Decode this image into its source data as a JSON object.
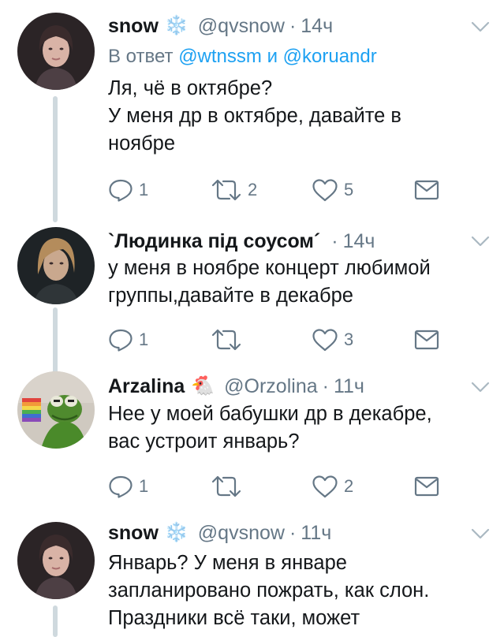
{
  "tweets": [
    {
      "name": "snow",
      "emoji": "❄️",
      "handle": "@qvsnow",
      "separator": "·",
      "time": "14ч",
      "reply_prefix": "В ответ",
      "reply_user1": "@wtnssm",
      "reply_and": "и",
      "reply_user2": "@koruandr",
      "lines": [
        "Ля, чё в октябре?",
        "У меня др в октябре, давайте в",
        "ноябре"
      ],
      "replies": "1",
      "retweets": "2",
      "likes": "5"
    },
    {
      "name": "`Людинка під соусом´",
      "handle": "",
      "separator": "·",
      "time": "14ч",
      "lines": [
        "у меня в ноябре концерт любимой",
        "группы,давайте в декабре"
      ],
      "replies": "1",
      "retweets": "",
      "likes": "3"
    },
    {
      "name": "Arzalina",
      "emoji": "🐔",
      "handle": "@Orzolina",
      "separator": "·",
      "time": "11ч",
      "lines": [
        "Нее у моей бабушки др в декабре,",
        "вас устроит январь?"
      ],
      "replies": "1",
      "retweets": "",
      "likes": "2"
    },
    {
      "name": "snow",
      "emoji": "❄️",
      "handle": "@qvsnow",
      "separator": "·",
      "time": "11ч",
      "lines": [
        "Январь?  У меня в январе",
        "запланировано пожрать, как слон.",
        "Праздники всё таки, может"
      ]
    }
  ],
  "colors": {
    "text": "#14171a",
    "secondary": "#657786",
    "link": "#1da1f2",
    "thread": "#cfd9de"
  },
  "icons": [
    "reply-icon",
    "retweet-icon",
    "like-icon",
    "message-icon",
    "chevron-down-icon",
    "snowflake-icon",
    "chicken-icon"
  ]
}
